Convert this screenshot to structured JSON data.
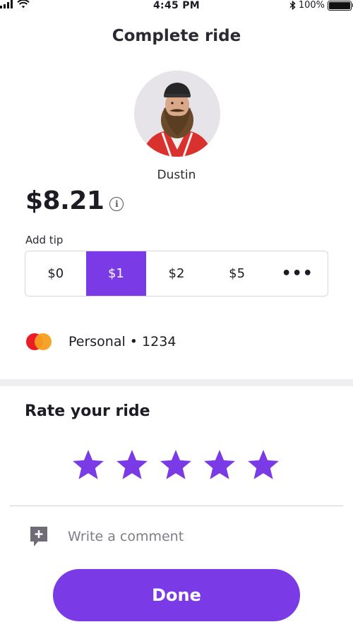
{
  "status_bar": {
    "time": "4:45 PM",
    "battery_text": "100%",
    "battery_level": 1.0,
    "icons": [
      "signal-icon",
      "wifi-icon",
      "bluetooth-icon",
      "battery-icon"
    ]
  },
  "header": {
    "title": "Complete ride"
  },
  "driver": {
    "name": "Dustin"
  },
  "fare": {
    "amount": "$8.21",
    "info_icon": "i"
  },
  "tip": {
    "label": "Add tip",
    "options": [
      "$0",
      "$1",
      "$2",
      "$5",
      "•••"
    ],
    "selected": "$1"
  },
  "payment": {
    "label": "Personal • 1234",
    "card_icon": "mastercard-icon"
  },
  "rating": {
    "title": "Rate your ride",
    "max_stars": 5
  },
  "comment": {
    "placeholder": "Write a comment",
    "icon": "add-comment-icon"
  },
  "actions": {
    "done_label": "Done"
  },
  "colors": {
    "accent": "#7a3ae5",
    "divider": "#efeef1",
    "text": "#1d1b24"
  }
}
